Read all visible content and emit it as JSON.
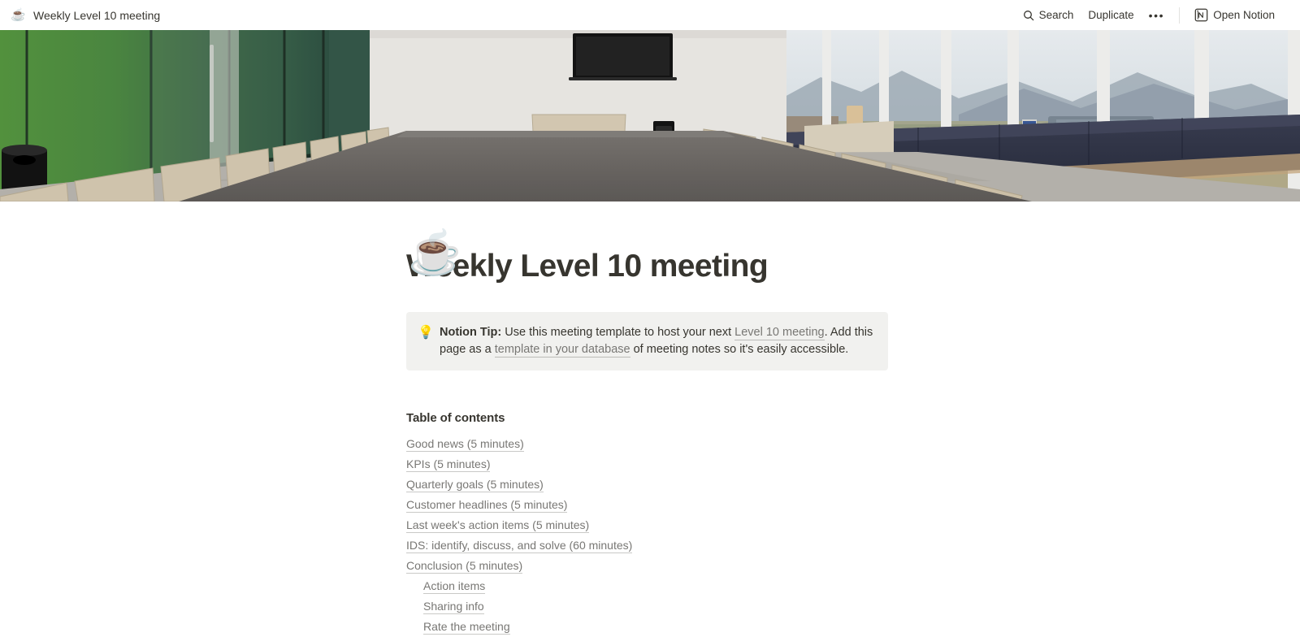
{
  "topbar": {
    "page_emoji": "☕",
    "page_title": "Weekly Level 10 meeting",
    "search_label": "Search",
    "duplicate_label": "Duplicate",
    "more_label": "•••",
    "open_notion_label": "Open Notion"
  },
  "cover": {
    "alt": "Modern conference room with long gray table, tan chairs, wall-mounted TV, navy bench seating and floor-to-ceiling windows overlooking mountains",
    "colors": {
      "glass_green": "#4f8f3f",
      "glass_green_dark": "#3f6e4a",
      "wall_white": "#eceae6",
      "table_gray": "#6e6a66",
      "chair_tan": "#d8cdb8",
      "bench_navy": "#2f3245",
      "sky": "#e8ecef",
      "mountain": "#9aa7b3",
      "land": "#b9b59a"
    }
  },
  "page": {
    "icon": "☕",
    "title": "Weekly Level 10 meeting"
  },
  "callout": {
    "emoji": "💡",
    "lead": "Notion Tip:",
    "text_1": " Use this meeting template to host your next ",
    "link_1": "Level 10 meeting",
    "text_2": ". Add this page as a ",
    "link_2": "template in your database",
    "text_3": " of meeting notes so it's easily accessible."
  },
  "toc": {
    "heading": "Table of contents",
    "items": [
      {
        "label": "Good news (5 minutes)",
        "indent": false
      },
      {
        "label": "KPIs (5 minutes)",
        "indent": false
      },
      {
        "label": "Quarterly goals (5 minutes)",
        "indent": false
      },
      {
        "label": "Customer headlines (5 minutes)",
        "indent": false
      },
      {
        "label": "Last week's action items (5 minutes)",
        "indent": false
      },
      {
        "label": "IDS: identify, discuss, and solve (60 minutes)",
        "indent": false
      },
      {
        "label": "Conclusion (5 minutes)",
        "indent": false
      },
      {
        "label": "Action items",
        "indent": true
      },
      {
        "label": "Sharing info",
        "indent": true
      },
      {
        "label": "Rate the meeting",
        "indent": true
      }
    ]
  }
}
